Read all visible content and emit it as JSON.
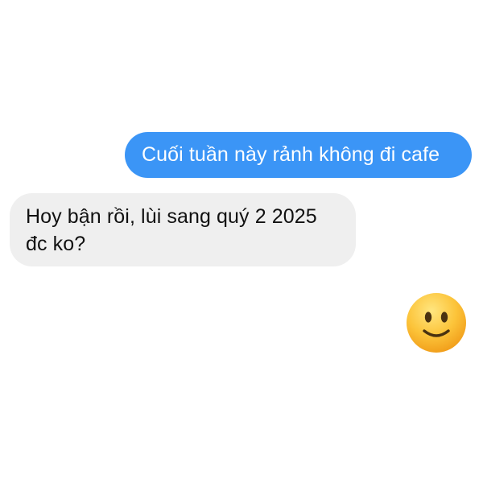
{
  "conversation": {
    "messages": [
      {
        "direction": "sent",
        "text": "Cuối tuần này rảnh không đi cafe"
      },
      {
        "direction": "received",
        "text": "Hoy bận rồi, lùi sang quý 2 2025 đc ko?"
      },
      {
        "direction": "sent",
        "type": "emoji",
        "emoji": "slightly-smiling-face-emoji"
      }
    ]
  },
  "colors": {
    "sent_bubble": "#3b95f6",
    "received_bubble": "#efefef",
    "background": "#ffffff"
  }
}
